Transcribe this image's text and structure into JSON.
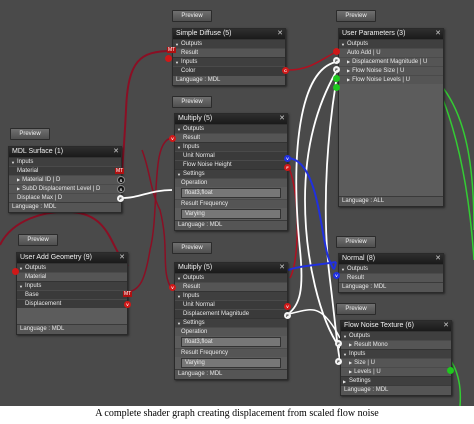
{
  "preview_label": "Preview",
  "simple_diffuse": {
    "title": "Simple Diffuse (5)",
    "outputs": "Outputs",
    "result": "Result",
    "inputs": "Inputs",
    "color": "Color",
    "language": "Language : MDL"
  },
  "user_parameters": {
    "title": "User Parameters (3)",
    "outputs": "Outputs",
    "auto_add": "Auto Add | U",
    "displacement_magnitude": "Displacement Magnitude | U",
    "flow_noise_size": "Flow Noise Size | U",
    "flow_noise_levels": "Flow Noise Levels | U",
    "language": "Language : ALL"
  },
  "mdl_surface": {
    "title": "MDL Surface (1)",
    "inputs": "Inputs",
    "material": "Material",
    "material_id": "Material ID | D",
    "subd_displacement_level": "SubD Displacement Level | D",
    "displace_max": "Displace Max | D",
    "language": "Language : MDL"
  },
  "multiply_top": {
    "title": "Multiply (5)",
    "outputs": "Outputs",
    "result": "Result",
    "inputs": "Inputs",
    "unit_normal": "Unit Normal",
    "flow_noise_height": "Flow Noise Height",
    "settings": "Settings",
    "operation": "Operation",
    "operation_value": "float3,float",
    "result_frequency": "Result Frequency",
    "frequency_value": "Varying",
    "language": "Language : MDL"
  },
  "user_add_geometry": {
    "title": "User Add Geometry (9)",
    "outputs": "Outputs",
    "material": "Material",
    "inputs": "Inputs",
    "base": "Base",
    "displacement": "Displacement",
    "language": "Language : MDL"
  },
  "normal": {
    "title": "Normal (8)",
    "outputs": "Outputs",
    "result": "Result",
    "language": "Language : MDL"
  },
  "multiply_bottom": {
    "title": "Multiply (5)",
    "outputs": "Outputs",
    "result": "Result",
    "inputs": "Inputs",
    "unit_normal": "Unit Normal",
    "displacement_magnitude": "Displacement Magnitude",
    "settings": "Settings",
    "operation": "Operation",
    "operation_value": "float3,float",
    "result_frequency": "Result Frequency",
    "frequency_value": "Varying",
    "language": "Language : MDL"
  },
  "flow_noise_texture": {
    "title": "Flow Noise Texture (6)",
    "outputs": "Outputs",
    "result_mono": "Result Mono",
    "inputs": "Inputs",
    "size": "Size | U",
    "levels": "Levels | U",
    "settings": "Settings",
    "language": "Language : MDL"
  },
  "port_labels": {
    "mt": "MT",
    "v": "V",
    "f": "F",
    "c": "C",
    "s": "S"
  },
  "caption": "A complete shader graph creating displacement from scaled flow noise",
  "colors": {
    "wire_red": "#8a0f24",
    "wire_white": "#ffffff",
    "wire_blue": "#2030e0",
    "wire_green": "#33cc33",
    "canvas": "#4a4a4a"
  }
}
